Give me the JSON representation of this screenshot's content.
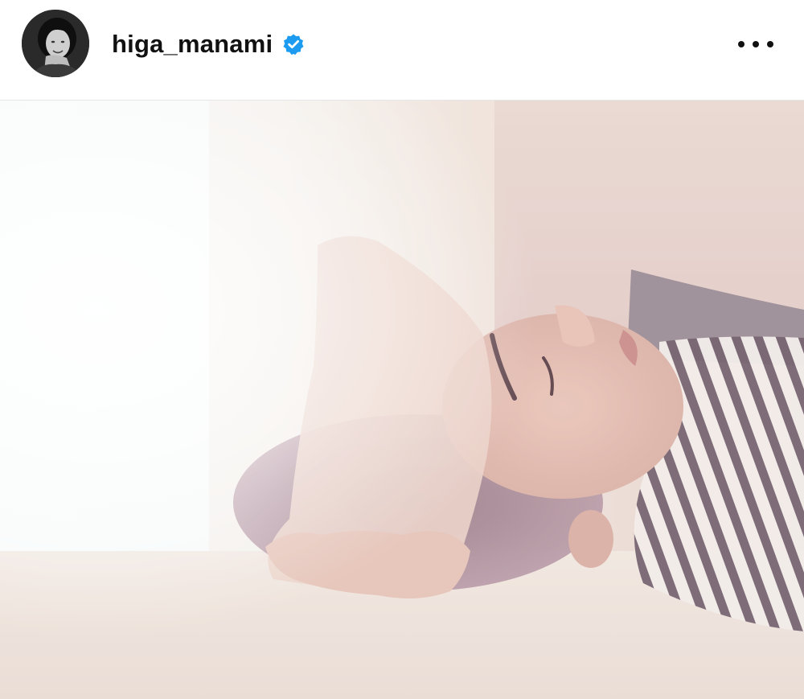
{
  "post": {
    "username": "higa_manami",
    "verified": true,
    "avatar_icon": "profile-photo",
    "more_icon": "more-horizontal-icon",
    "verified_icon": "verified-badge-icon",
    "colors": {
      "verified_badge": "#1d9bf0",
      "text": "#111111",
      "header_bg": "#ffffff"
    },
    "photo": {
      "subject_icon": "post-photo"
    }
  }
}
